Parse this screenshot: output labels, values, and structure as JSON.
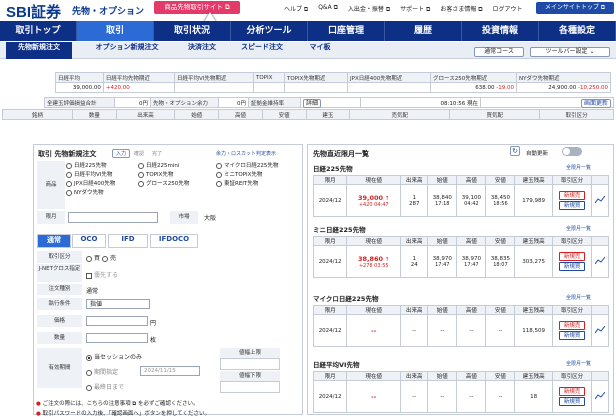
{
  "header": {
    "logo": "SBI証券",
    "logo_sub": "先物・オプション",
    "promo": "商品先物取引サイト ⧉",
    "links": [
      "ヘルプ ⧉",
      "Q&A ⧉",
      "入出金・振替 ⧉",
      "サポート ⧉",
      "お客さま情報 ⧉",
      "ログアウト"
    ],
    "main_site": "メインサイトトップ ⧉"
  },
  "nav": [
    "取引トップ",
    "取引",
    "取引状況",
    "分析ツール",
    "口座管理",
    "履歴",
    "投資情報",
    "各種設定"
  ],
  "subnav": {
    "tabs": [
      "先物新規注文",
      "オプション新規注文",
      "決済注文",
      "スピード注文",
      "マイ板"
    ],
    "btn1": "通常コース",
    "btn2": "ツールバー設定 ⌄"
  },
  "strip": {
    "heads": [
      "日経平均",
      "日経平均先物期近",
      "日経平均VI先物期近",
      "TOPIX",
      "TOPIX先物期近",
      "JPX日経400先物期近",
      "グロース250先物期近",
      "NYダウ先物期近"
    ],
    "values": [
      "39,000.00",
      "+420.00",
      "",
      "",
      "",
      "",
      "638.00",
      "-19.00",
      "24,900.00",
      "-10,250.00"
    ],
    "r2": [
      "全建玉評価損益合計",
      "0円",
      "先物・オプション余力",
      "0円",
      "証拠金維持率",
      "詳細",
      "",
      "08:10:56 現在",
      "",
      ""
    ],
    "update": "画面更新",
    "r3": [
      "銘柄",
      "数量",
      "出来高",
      "始値",
      "高値",
      "安値",
      "建玉",
      "売気配",
      "",
      "買気配",
      "",
      "取引区分"
    ]
  },
  "order": {
    "title": "取引 先物新規注文",
    "chip1": "入力",
    "chip2": "確認",
    "chip3": "完了",
    "link": "余力・ロスカット判定表示",
    "product_label": "商品",
    "products": [
      "日経225先物",
      "日経225mini",
      "マイクロ日経225先物",
      "日経平均VI先物",
      "TOPIX先物",
      "ミニTOPIX先物",
      "JPX日経400先物",
      "グロース250先物",
      "東証REIT先物",
      "NYダウ先物"
    ],
    "month_label": "限月",
    "market_label": "市場",
    "market_value": "大阪",
    "tabs": [
      "通常",
      "OCO",
      "IFD",
      "IFDOCO"
    ],
    "side_label": "取引区分",
    "buy": "買",
    "sell": "売",
    "jnet_label": "J-NETクロス指定",
    "jnet_opt": "優先する",
    "type_label": "注文種別",
    "type_value": "通常",
    "cond_label": "執行条件",
    "cond_value": "指値",
    "price_label": "価格",
    "unit_yen": "円",
    "qty_label": "数量",
    "unit_lot": "枚",
    "period_label": "有効期間",
    "period_opts": [
      "当セッションのみ",
      "期間指定",
      "最終日まで"
    ],
    "date_placeholder": "2024/11/15",
    "limit_up": "値幅上限",
    "limit_down": "値幅下限",
    "note1": "ご注文の際には、こちらの注意事項 ⧉ を必ずご確認ください。",
    "note2": "取引パスワードの入力後、「確認画面へ」ボタンを押してください。"
  },
  "prices": {
    "title": "先物直近限月一覧",
    "auto_label": "自動更新",
    "head": [
      "限月",
      "現在値",
      "出来高",
      "始値",
      "高値",
      "安値",
      "建玉残高",
      "取引区分"
    ],
    "all_link": "全限月一覧",
    "sections": [
      {
        "name": "日経225先物",
        "month": "2024/12",
        "price": "39,000",
        "arrow": "↑",
        "change": "+420 04:47",
        "vol": "1",
        "oi_note": "287",
        "open": "38,840",
        "open_t": "17:18",
        "high": "39,100",
        "high_t": "04:42",
        "low": "38,450",
        "low_t": "18:56",
        "oi": "179,989",
        "sell": "新規売",
        "buy": "新規買"
      },
      {
        "name": "ミニ日経225先物",
        "month": "2024/12",
        "price": "38,860",
        "arrow": "↑",
        "change": "+278 03:55",
        "vol": "1",
        "oi_note": "24",
        "open": "38,970",
        "open_t": "17:47",
        "high": "38,970",
        "high_t": "17:47",
        "low": "38,835",
        "low_t": "18:07",
        "oi": "303,275",
        "sell": "新規売",
        "buy": "新規買"
      },
      {
        "name": "マイクロ日経225先物",
        "month": "2024/12",
        "price": "--",
        "arrow": "",
        "change": "",
        "vol": "--",
        "oi_note": "",
        "open": "--",
        "open_t": "",
        "high": "--",
        "high_t": "",
        "low": "--",
        "low_t": "",
        "oi": "118,509",
        "sell": "新規売",
        "buy": "新規買"
      },
      {
        "name": "日経平均VI先物",
        "month": "2024/12",
        "price": "--",
        "arrow": "",
        "change": "",
        "vol": "--",
        "oi_note": "",
        "open": "--",
        "open_t": "",
        "high": "--",
        "high_t": "",
        "low": "--",
        "low_t": "",
        "oi": "18",
        "sell": "新規売",
        "buy": "新規買"
      }
    ]
  }
}
